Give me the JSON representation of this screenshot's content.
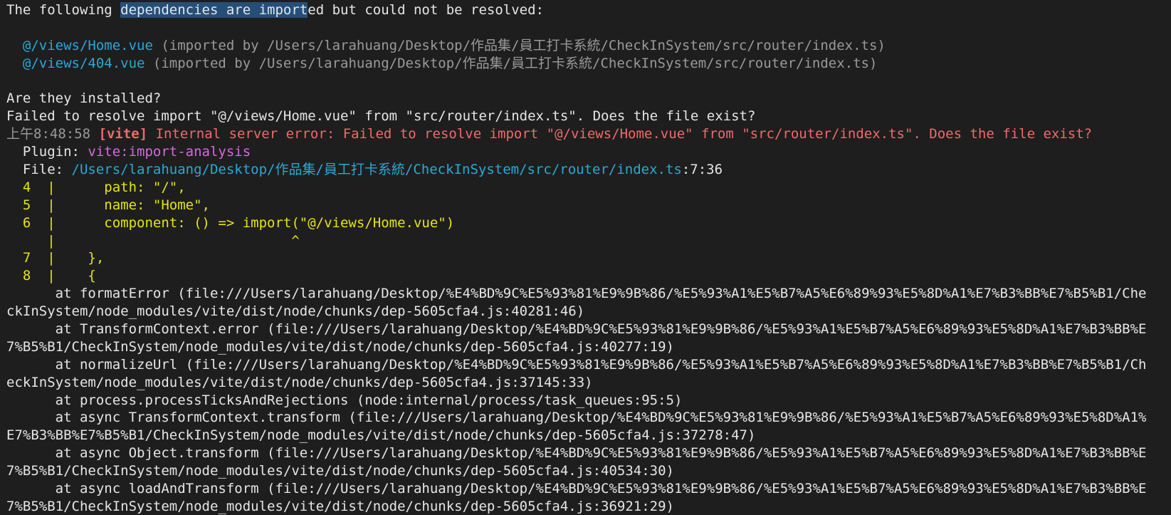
{
  "colors": {
    "background": "#1e1e1e",
    "text": "#e6e6e6",
    "dim": "#9a9a9a",
    "path": "#29a9d8",
    "error": "#f06a6a",
    "plugin": "#d868e0",
    "code_frame": "#e5e510",
    "selection": "#264f78"
  },
  "header": {
    "pre": "The following ",
    "selected": "dependencies are import",
    "post": "ed but could not be resolved:"
  },
  "unresolved": [
    {
      "module": "  @/views/Home.vue",
      "importer": " (imported by /Users/larahuang/Desktop/作品集/員工打卡系統/CheckInSystem/src/router/index.ts)"
    },
    {
      "module": "  @/views/404.vue",
      "importer": " (imported by /Users/larahuang/Desktop/作品集/員工打卡系統/CheckInSystem/src/router/index.ts)"
    }
  ],
  "question": "Are they installed?",
  "failed_line": "Failed to resolve import \"@/views/Home.vue\" from \"src/router/index.ts\". Does the file exist?",
  "error_line": {
    "time": "上午8:48:58",
    "tag": " [vite]",
    "message": " Internal server error: Failed to resolve import \"@/views/Home.vue\" from \"src/router/index.ts\". Does the file exist?"
  },
  "plugin_line": {
    "label": "  Plugin: ",
    "value": "vite:import-analysis"
  },
  "file_line": {
    "label": "  File: ",
    "path": "/Users/larahuang/Desktop/作品集/員工打卡系統/CheckInSystem/src/router/index.ts",
    "pos": ":7:36"
  },
  "code_frame": [
    "  4  |      path: \"/\",",
    "  5  |      name: \"Home\",",
    "  6  |      component: () => import(\"@/views/Home.vue\")",
    "     |                             ^",
    "  7  |    },",
    "  8  |    {"
  ],
  "stack": [
    "      at formatError (file:///Users/larahuang/Desktop/%E4%BD%9C%E5%93%81%E9%9B%86/%E5%93%A1%E5%B7%A5%E6%89%93%E5%8D%A1%E7%B3%BB%E7%B5%B1/Che",
    "ckInSystem/node_modules/vite/dist/node/chunks/dep-5605cfa4.js:40281:46)",
    "      at TransformContext.error (file:///Users/larahuang/Desktop/%E4%BD%9C%E5%93%81%E9%9B%86/%E5%93%A1%E5%B7%A5%E6%89%93%E5%8D%A1%E7%B3%BB%E",
    "7%B5%B1/CheckInSystem/node_modules/vite/dist/node/chunks/dep-5605cfa4.js:40277:19)",
    "      at normalizeUrl (file:///Users/larahuang/Desktop/%E4%BD%9C%E5%93%81%E9%9B%86/%E5%93%A1%E5%B7%A5%E6%89%93%E5%8D%A1%E7%B3%BB%E7%B5%B1/Ch",
    "eckInSystem/node_modules/vite/dist/node/chunks/dep-5605cfa4.js:37145:33)",
    "      at process.processTicksAndRejections (node:internal/process/task_queues:95:5)",
    "      at async TransformContext.transform (file:///Users/larahuang/Desktop/%E4%BD%9C%E5%93%81%E9%9B%86/%E5%93%A1%E5%B7%A5%E6%89%93%E5%8D%A1%",
    "E7%B3%BB%E7%B5%B1/CheckInSystem/node_modules/vite/dist/node/chunks/dep-5605cfa4.js:37278:47)",
    "      at async Object.transform (file:///Users/larahuang/Desktop/%E4%BD%9C%E5%93%81%E9%9B%86/%E5%93%A1%E5%B7%A5%E6%89%93%E5%8D%A1%E7%B3%BB%E",
    "7%B5%B1/CheckInSystem/node_modules/vite/dist/node/chunks/dep-5605cfa4.js:40534:30)",
    "      at async loadAndTransform (file:///Users/larahuang/Desktop/%E4%BD%9C%E5%93%81%E9%9B%86/%E5%93%A1%E5%B7%A5%E6%89%93%E5%8D%A1%E7%B3%BB%E",
    "7%B5%B1/CheckInSystem/node_modules/vite/dist/node/chunks/dep-5605cfa4.js:36921:29)"
  ]
}
